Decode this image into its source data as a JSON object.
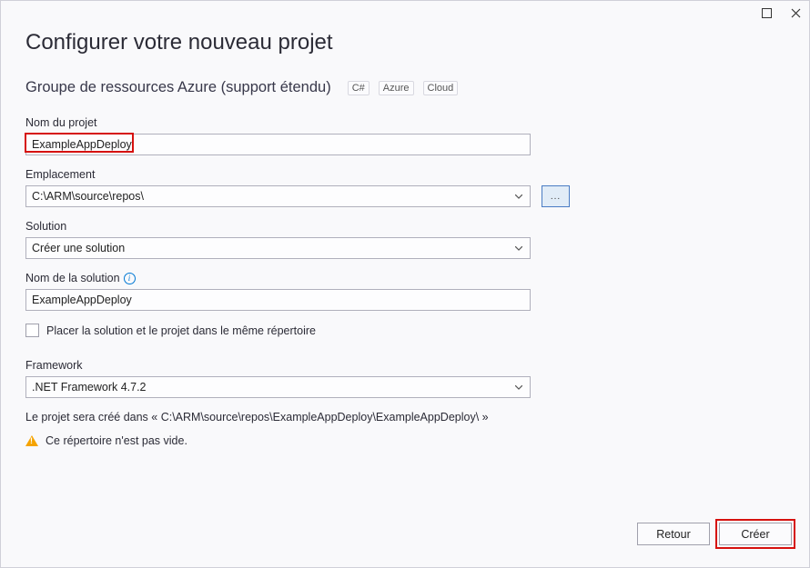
{
  "window": {
    "title": "Configurer votre nouveau projet"
  },
  "project": {
    "template_name": "Groupe de ressources Azure (support étendu)",
    "tags": [
      "C#",
      "Azure",
      "Cloud"
    ]
  },
  "fields": {
    "project_name": {
      "label": "Nom du projet",
      "value": "ExampleAppDeploy"
    },
    "location": {
      "label": "Emplacement",
      "value": "C:\\ARM\\source\\repos\\",
      "browse_label": "..."
    },
    "solution": {
      "label": "Solution",
      "value": "Créer une solution"
    },
    "solution_name": {
      "label": "Nom de la solution",
      "value": "ExampleAppDeploy"
    },
    "same_dir_checkbox": {
      "label": "Placer la solution et le projet dans le même répertoire",
      "checked": false
    },
    "framework": {
      "label": "Framework",
      "value": ".NET Framework 4.7.2"
    }
  },
  "messages": {
    "creation_path": "Le projet sera créé dans « C:\\ARM\\source\\repos\\ExampleAppDeploy\\ExampleAppDeploy\\ »",
    "warning": "Ce répertoire n'est pas vide."
  },
  "buttons": {
    "back": "Retour",
    "create": "Créer"
  }
}
